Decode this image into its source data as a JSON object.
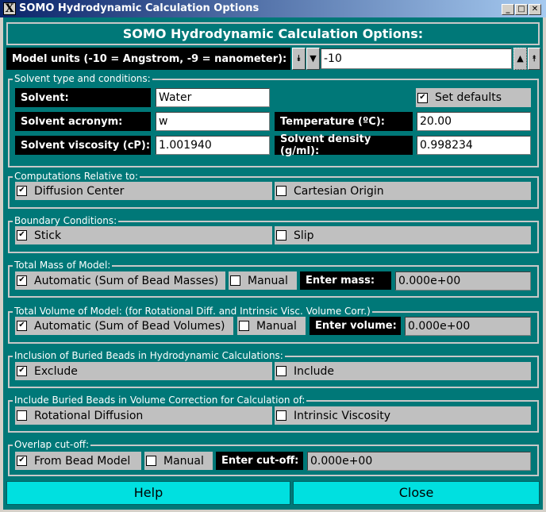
{
  "window": {
    "title": "SOMO Hydrodynamic Calculation Options"
  },
  "header": "SOMO Hydrodynamic Calculation Options:",
  "model_units": {
    "label": "Model units (-10 = Angstrom, -9 = nanometer):",
    "value": "-10"
  },
  "solvent": {
    "group": "Solvent type and conditions:",
    "solvent_label": "Solvent:",
    "solvent_value": "Water",
    "set_defaults": "Set defaults",
    "set_defaults_checked": true,
    "acronym_label": "Solvent acronym:",
    "acronym_value": "w",
    "temperature_label": "Temperature (ºC):",
    "temperature_value": "20.00",
    "viscosity_label": "Solvent viscosity (cP):",
    "viscosity_value": "1.001940",
    "density_label": "Solvent density (g/ml):",
    "density_value": "0.998234"
  },
  "computations": {
    "group": "Computations Relative to:",
    "opt1": "Diffusion Center",
    "opt2": "Cartesian Origin",
    "checked": "opt1"
  },
  "boundary": {
    "group": "Boundary Conditions:",
    "opt1": "Stick",
    "opt2": "Slip",
    "checked": "opt1"
  },
  "mass": {
    "group": "Total Mass of Model:",
    "auto": "Automatic (Sum of Bead Masses)",
    "manual": "Manual",
    "enter": "Enter mass:",
    "value": "0.000e+00"
  },
  "volume": {
    "group": "Total Volume of Model: (for Rotational Diff. and Intrinsic Visc. Volume Corr.)",
    "auto": "Automatic (Sum of Bead Volumes)",
    "manual": "Manual",
    "enter": "Enter volume:",
    "value": "0.000e+00"
  },
  "buried": {
    "group": "Inclusion of Buried Beads in Hydrodynamic Calculations:",
    "opt1": "Exclude",
    "opt2": "Include",
    "checked": "opt1"
  },
  "volcorr": {
    "group": "Include Buried Beads in Volume Correction for Calculation of:",
    "opt1": "Rotational Diffusion",
    "opt2": "Intrinsic Viscosity"
  },
  "overlap": {
    "group": "Overlap cut-off:",
    "auto": "From Bead Model",
    "manual": "Manual",
    "enter": "Enter cut-off:",
    "value": "0.000e+00"
  },
  "buttons": {
    "help": "Help",
    "close": "Close"
  },
  "colors": {
    "background": "#007878",
    "button": "#00e0e0"
  }
}
